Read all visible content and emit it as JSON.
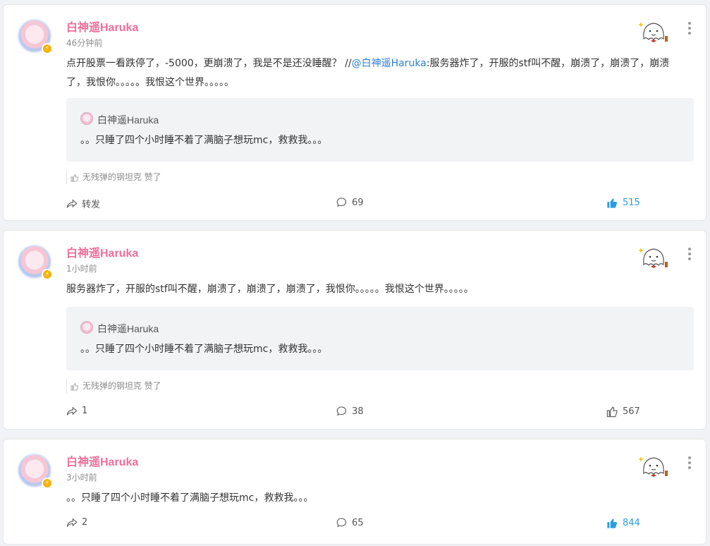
{
  "posts": [
    {
      "username": "白神遥Haruka",
      "time": "46分钟前",
      "text_main": "点开股票一看跌停了，-5000，更崩溃了，我是不是还没睡醒？ //",
      "mention": "@白神遥Haruka",
      "text_rest": ":服务器炸了，开服的stf叫不醒，崩溃了，崩溃了，崩溃了，我恨你。。。。。我恨这个世界。。。。。",
      "quote_user": "白神遥Haruka",
      "quote_text": "。。只睡了四个小时睡不着了满脑子想玩mc，救救我。。。",
      "liked_user": "无残弹的钢坦克",
      "liked_suffix": "赞了",
      "repost": "转发",
      "comments": "69",
      "likes": "515",
      "like_active": true
    },
    {
      "username": "白神遥Haruka",
      "time": "1小时前",
      "text_main": "服务器炸了，开服的stf叫不醒，崩溃了，崩溃了，崩溃了，我恨你。。。。。我恨这个世界。。。。。",
      "quote_user": "白神遥Haruka",
      "quote_text": "。。只睡了四个小时睡不着了满脑子想玩mc，救救我。。。",
      "liked_user": "无残弹的钢坦克",
      "liked_suffix": "赞了",
      "repost": "1",
      "comments": "38",
      "likes": "567",
      "like_active": false
    },
    {
      "username": "白神遥Haruka",
      "time": "3小时前",
      "text_main": "。。只睡了四个小时睡不着了满脑子想玩mc，救救我。。。",
      "repost": "2",
      "comments": "65",
      "likes": "844",
      "like_active": true
    }
  ],
  "icons": {
    "more": "more-dots-icon",
    "repost": "share-arrow-icon",
    "comment": "comment-bubble-icon",
    "like": "thumbs-up-icon",
    "decoration": "ghost-sticker-icon"
  },
  "colors": {
    "username": "#ee6f9a",
    "mention": "#2b7fd6",
    "like_active": "#2a9ce0"
  }
}
